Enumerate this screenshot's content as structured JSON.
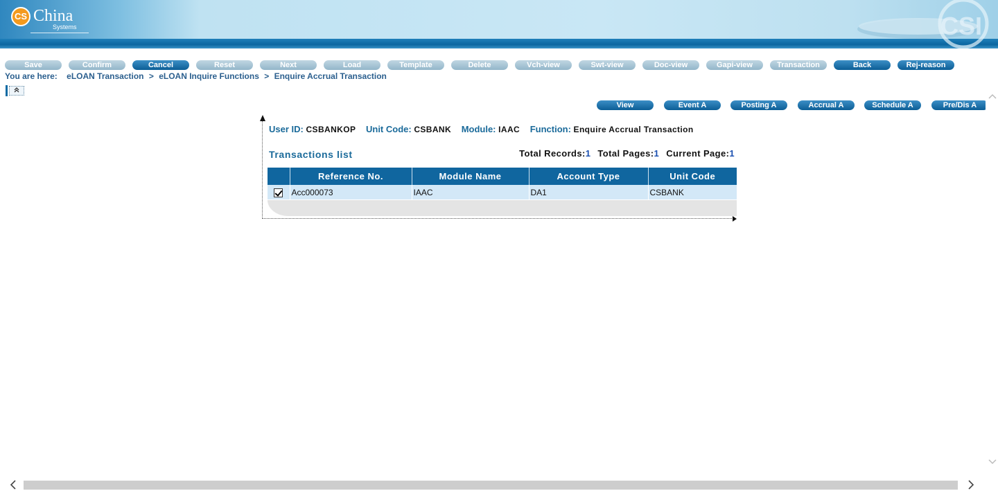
{
  "header": {
    "logo_badge": "CS",
    "logo_name": "China",
    "logo_sub": "Systems",
    "corner_watermark": "CSI"
  },
  "toolbar": [
    {
      "label": "Save",
      "enabled": false
    },
    {
      "label": "Confirm",
      "enabled": false
    },
    {
      "label": "Cancel",
      "enabled": true
    },
    {
      "label": "Reset",
      "enabled": false
    },
    {
      "label": "Next",
      "enabled": false
    },
    {
      "label": "Load",
      "enabled": false
    },
    {
      "label": "Template",
      "enabled": false
    },
    {
      "label": "Delete",
      "enabled": false
    },
    {
      "label": "Vch-view",
      "enabled": false
    },
    {
      "label": "Swt-view",
      "enabled": false
    },
    {
      "label": "Doc-view",
      "enabled": false
    },
    {
      "label": "Gapi-view",
      "enabled": false
    },
    {
      "label": "Transaction",
      "enabled": false
    },
    {
      "label": "Back",
      "enabled": true
    },
    {
      "label": "Rej-reason",
      "enabled": true
    }
  ],
  "breadcrumb": {
    "prefix": "You are here:",
    "items": [
      "eLOAN Transaction",
      "eLOAN Inquire Functions",
      "Enquire Accrual Transaction"
    ],
    "separator": ">"
  },
  "collapse_icon": "double-chevron-up",
  "actions": [
    {
      "label": "View"
    },
    {
      "label": "Event A"
    },
    {
      "label": "Posting A"
    },
    {
      "label": "Accrual A"
    },
    {
      "label": "Schedule A"
    },
    {
      "label": "Pre/Dis A"
    }
  ],
  "info": {
    "user_id_label": "User ID:",
    "user_id": "CSBANKOP",
    "unit_code_label": "Unit Code:",
    "unit_code": "CSBANK",
    "module_label": "Module:",
    "module": "IAAC",
    "function_label": "Function:",
    "function": "Enquire Accrual Transaction"
  },
  "list": {
    "title": "Transactions list",
    "total_records_label": "Total Records:",
    "total_records": "1",
    "total_pages_label": "Total Pages:",
    "total_pages": "1",
    "current_page_label": "Current Page:",
    "current_page": "1",
    "columns": [
      "Reference No.",
      "Module Name",
      "Account Type",
      "Unit Code"
    ],
    "rows": [
      {
        "checked": true,
        "cells": [
          "Acc000073",
          "IAAC",
          "DA1",
          "CSBANK"
        ]
      }
    ]
  },
  "colors": {
    "accent": "#10669f",
    "row_bg": "#d3e8f7",
    "label": "#1a6a9a",
    "badge": "#f39a1e"
  }
}
